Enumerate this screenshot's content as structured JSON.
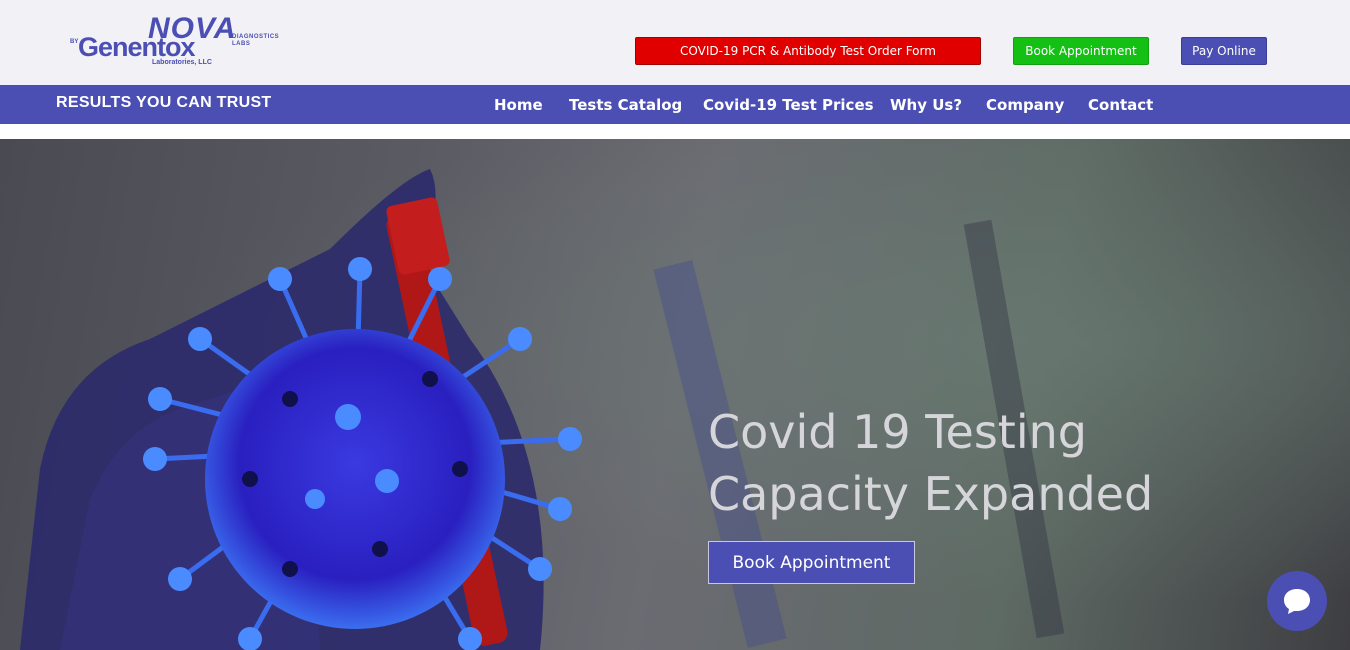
{
  "brand": {
    "by": "BY",
    "name": "Genentox",
    "sub_brand": "NOVA",
    "division": "DIAGNOSTICS LABS",
    "legal": "Laboratories, LLC"
  },
  "top_buttons": {
    "covid_form": "COVID-19 PCR & Antibody Test Order Form",
    "book": "Book Appointment",
    "pay": "Pay Online"
  },
  "nav": {
    "tagline": "RESULTS YOU CAN TRUST",
    "items": [
      "Home",
      "Tests Catalog",
      "Covid-19 Test Prices",
      "Why Us?",
      "Company",
      "Contact"
    ]
  },
  "hero": {
    "title_line1": "Covid 19 Testing",
    "title_line2": "Capacity Expanded",
    "cta": "Book Appointment"
  },
  "colors": {
    "brand": "#4b4fb3",
    "danger": "#e00000",
    "success": "#13c013"
  },
  "icons": {
    "chat": "chat-bubble-icon",
    "virus": "virus-illustration"
  }
}
